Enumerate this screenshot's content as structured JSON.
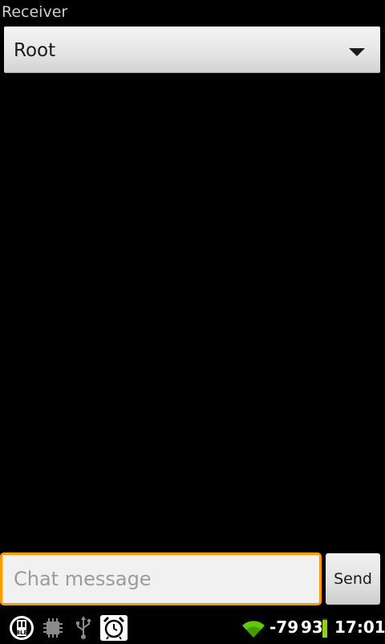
{
  "receiver": {
    "label": "Receiver",
    "selected": "Root"
  },
  "chat": {
    "placeholder": "Chat message",
    "value": "",
    "send_label": "Send"
  },
  "status_bar": {
    "icons": [
      "ble-app-icon",
      "chip-icon",
      "usb-icon",
      "alarm-clock-icon"
    ],
    "signal_strength": "-79",
    "battery_percent": "93",
    "battery_level": 0.93,
    "time": "17:01",
    "wifi_color": "#5fcc00",
    "battery_color": "#8fd400"
  },
  "colors": {
    "focus_border": "#ff9a00",
    "background": "#000000"
  }
}
